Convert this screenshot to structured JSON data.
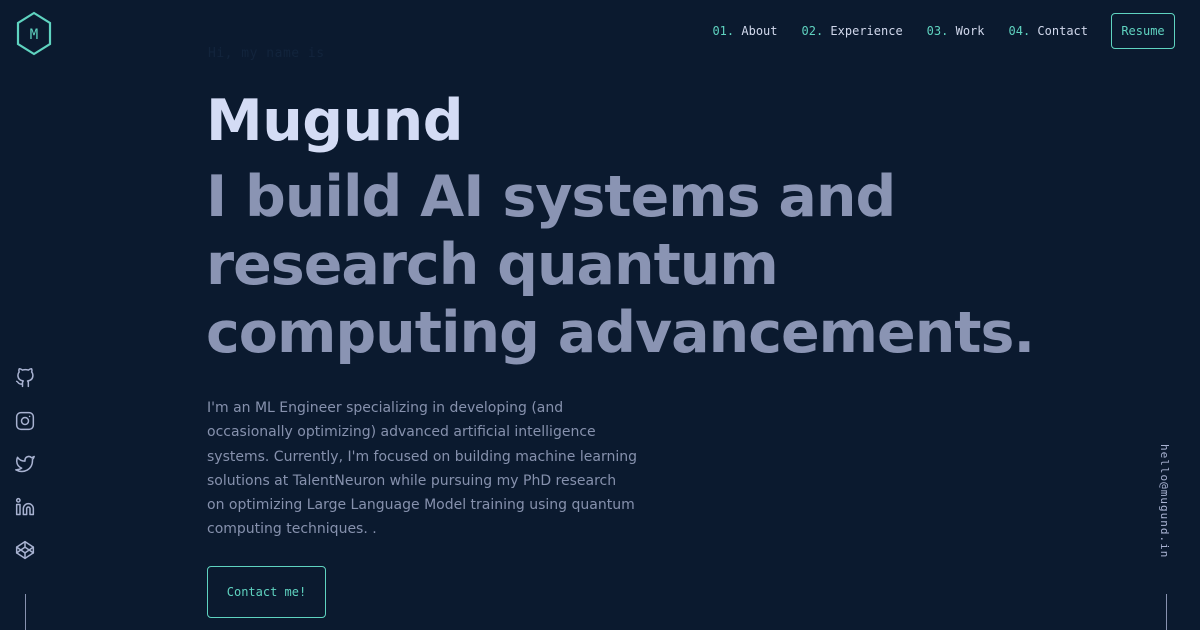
{
  "logo": {
    "letter": "M",
    "accent": "#5fd3c0"
  },
  "nav": {
    "items": [
      {
        "num": "01.",
        "label": "About"
      },
      {
        "num": "02.",
        "label": "Experience"
      },
      {
        "num": "03.",
        "label": "Work"
      },
      {
        "num": "04.",
        "label": "Contact"
      }
    ],
    "resume_label": "Resume"
  },
  "hero": {
    "intro": "Hi, my name is",
    "name": "Mugund",
    "tagline": "I build AI systems and research quantum computing advancements.",
    "description": "I'm an ML Engineer specializing in developing (and occasionally optimizing) advanced artificial intelligence systems. Currently, I'm focused on building machine learning solutions at TalentNeuron while pursuing my PhD research on optimizing Large Language Model training using quantum computing techniques. .",
    "cta_label": "Contact me!"
  },
  "social": {
    "icons": [
      "github-icon",
      "instagram-icon",
      "twitter-icon",
      "linkedin-icon",
      "codepen-icon"
    ]
  },
  "email": "hello@mugund.in",
  "colors": {
    "background": "#0b1a2f",
    "accent": "#5fd3c0",
    "name": "#d4dcf5",
    "tagline": "#8a94b3",
    "body_text": "#8691ad"
  }
}
